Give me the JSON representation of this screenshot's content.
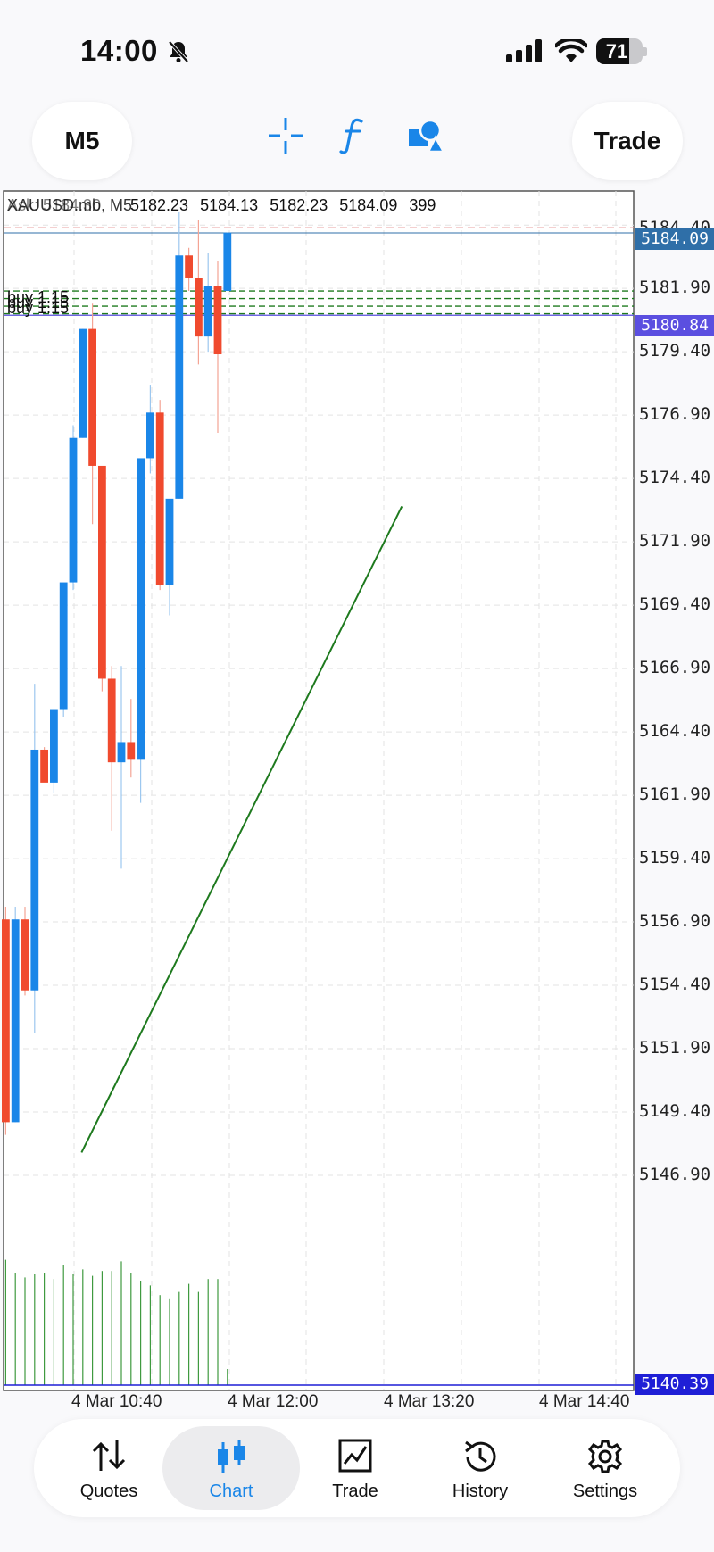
{
  "status_bar": {
    "time": "14:00",
    "battery_percent": "71",
    "icons": [
      "bell-slash-icon",
      "cellular-signal-icon",
      "wifi-icon",
      "battery-icon"
    ]
  },
  "toolbar": {
    "timeframe_label": "M5",
    "trade_label": "Trade",
    "icons": [
      "crosshair-icon",
      "function-icon",
      "shapes-icon"
    ],
    "accent": "#1a86e8"
  },
  "chart_info": {
    "symbol_label": "XAUUSD.mb, M5",
    "overlay_text": "Ask: 5184.30",
    "open": "5182.23",
    "high": "5184.13",
    "low": "5182.23",
    "close": "5184.09",
    "volume": "399",
    "positions": [
      {
        "label": "buy 1.15"
      },
      {
        "label": "buy 1.15"
      },
      {
        "label": "buy 1.15"
      }
    ],
    "bid_tag": "5184.09",
    "last_tag": "5180.84",
    "volume_tag": "5140.39"
  },
  "chart_data": {
    "type": "candlestick",
    "y_ticks": [
      "5184.40",
      "5181.90",
      "5179.40",
      "5176.90",
      "5174.40",
      "5171.90",
      "5169.40",
      "5166.90",
      "5164.40",
      "5161.90",
      "5159.40",
      "5156.90",
      "5154.40",
      "5151.90",
      "5149.40",
      "5146.90"
    ],
    "x_ticks": [
      "4 Mar 10:40",
      "4 Mar 12:00",
      "4 Mar 13:20",
      "4 Mar 14:40"
    ],
    "ylim": [
      5144.4,
      5184.9
    ],
    "up_color": "#1a86e8",
    "down_color": "#f04a2e",
    "candles": [
      {
        "o": 5157.0,
        "h": 5157.5,
        "l": 5148.5,
        "c": 5149.0
      },
      {
        "o": 5149.0,
        "h": 5157.5,
        "l": 5149.0,
        "c": 5157.0
      },
      {
        "o": 5157.0,
        "h": 5157.5,
        "l": 5154.0,
        "c": 5154.2
      },
      {
        "o": 5154.2,
        "h": 5166.3,
        "l": 5152.5,
        "c": 5163.7
      },
      {
        "o": 5163.7,
        "h": 5163.8,
        "l": 5162.5,
        "c": 5162.4
      },
      {
        "o": 5162.4,
        "h": 5165.3,
        "l": 5162.0,
        "c": 5165.3
      },
      {
        "o": 5165.3,
        "h": 5170.0,
        "l": 5165.0,
        "c": 5170.3
      },
      {
        "o": 5170.3,
        "h": 5176.5,
        "l": 5170.0,
        "c": 5176.0
      },
      {
        "o": 5176.0,
        "h": 5180.3,
        "l": 5176.0,
        "c": 5180.3
      },
      {
        "o": 5180.3,
        "h": 5181.3,
        "l": 5172.6,
        "c": 5174.9
      },
      {
        "o": 5174.9,
        "h": 5174.9,
        "l": 5166.0,
        "c": 5166.5
      },
      {
        "o": 5166.5,
        "h": 5167.0,
        "l": 5160.5,
        "c": 5163.2
      },
      {
        "o": 5163.2,
        "h": 5167.0,
        "l": 5159.0,
        "c": 5164.0
      },
      {
        "o": 5164.0,
        "h": 5165.7,
        "l": 5162.6,
        "c": 5163.3
      },
      {
        "o": 5163.3,
        "h": 5172.3,
        "l": 5161.6,
        "c": 5175.2
      },
      {
        "o": 5175.2,
        "h": 5178.1,
        "l": 5174.6,
        "c": 5177.0
      },
      {
        "o": 5177.0,
        "h": 5177.5,
        "l": 5170.0,
        "c": 5170.2
      },
      {
        "o": 5170.2,
        "h": 5172.0,
        "l": 5169.0,
        "c": 5173.6
      },
      {
        "o": 5173.6,
        "h": 5184.9,
        "l": 5173.6,
        "c": 5183.2
      },
      {
        "o": 5183.2,
        "h": 5183.5,
        "l": 5181.8,
        "c": 5182.3
      },
      {
        "o": 5182.3,
        "h": 5184.6,
        "l": 5178.9,
        "c": 5180.0
      },
      {
        "o": 5180.0,
        "h": 5183.3,
        "l": 5179.4,
        "c": 5182.0
      },
      {
        "o": 5182.0,
        "h": 5183.0,
        "l": 5176.2,
        "c": 5179.3
      },
      {
        "o": 5181.8,
        "h": 5184.1,
        "l": 5181.8,
        "c": 5184.1
      }
    ],
    "volume": [
      0.78,
      0.7,
      0.67,
      0.69,
      0.7,
      0.66,
      0.75,
      0.69,
      0.72,
      0.68,
      0.71,
      0.71,
      0.77,
      0.7,
      0.65,
      0.62,
      0.56,
      0.54,
      0.58,
      0.63,
      0.58,
      0.66,
      0.66,
      0.1
    ],
    "levels": {
      "ask": 5184.3,
      "bid": 5184.09,
      "last": 5180.84,
      "positions": [
        5181.8,
        5181.5,
        5181.2,
        5180.9
      ]
    },
    "trendline": {
      "from": {
        "x": "4 Mar 10:25",
        "y": 5147.8
      },
      "to": {
        "x": "4 Mar 13:10",
        "y": 5173.3
      },
      "color": "#1e7a1e"
    }
  },
  "nav": {
    "items": [
      {
        "label": "Quotes",
        "icon": "arrows-up-down-icon"
      },
      {
        "label": "Chart",
        "icon": "candlestick-icon"
      },
      {
        "label": "Trade",
        "icon": "trend-chart-icon"
      },
      {
        "label": "History",
        "icon": "history-clock-icon"
      },
      {
        "label": "Settings",
        "icon": "gear-icon"
      }
    ],
    "active": "Chart"
  }
}
